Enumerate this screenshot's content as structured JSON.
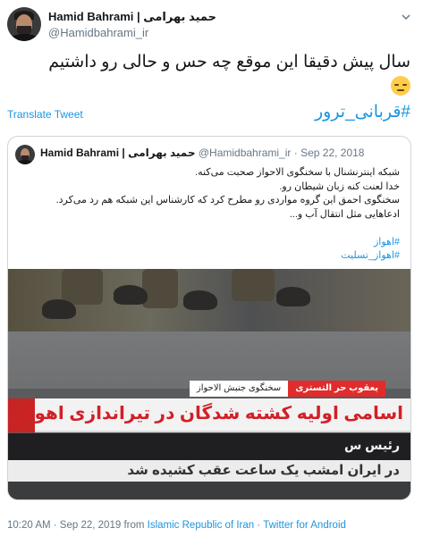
{
  "tweet": {
    "author_name": "Hamid Bahrami | حمید بهرامی",
    "handle": "@Hamidbahrami_ir",
    "text": "سال پیش دقیقا این موقع چه حس و حالی رو داشتیم",
    "emoji": "pensive-face-emoji",
    "hashtag": "#قربانی_ترور",
    "translate_label": "Translate Tweet"
  },
  "quoted": {
    "author_name": "Hamid Bahrami | حمید بهرامی",
    "handle": "@Hamidbahrami_ir",
    "separator": "·",
    "date": "Sep 22, 2018",
    "lines": [
      "شبکه اینترنشنال با سخنگوی الاحواز صحبت می‌کنه.",
      "خدا لعنت کنه زبان شیطان رو.",
      "سخنگوی احمق این گروه مواردی رو مطرح کرد که کارشناس این شبکه هم رد می‌کرد.",
      "ادعاهایی مثل انتقال آب و..."
    ],
    "hashtags": [
      "#اهواز",
      "#اهواز_تسلیت"
    ],
    "image": {
      "nameplate_name": "یعقوب حر التستری",
      "nameplate_title": "سخنگوی جنبش الاحواز",
      "headline": "اسامی اولیه کشته شدگان در تیراندازی اهواز منتشر شد",
      "ticker_1": "رئیس س",
      "ticker_2": "در ایران امشب یک ساعت عقب کشیده شد"
    }
  },
  "footer": {
    "time_date": "10:20 AM · Sep 22, 2019",
    "from_word": "from",
    "location": "Islamic Republic of Iran",
    "dot": "·",
    "client": "Twitter for Android"
  },
  "colors": {
    "link": "#1b95e0",
    "muted": "#657786",
    "border": "#ccd6dd",
    "headline_red": "#d21f26"
  }
}
